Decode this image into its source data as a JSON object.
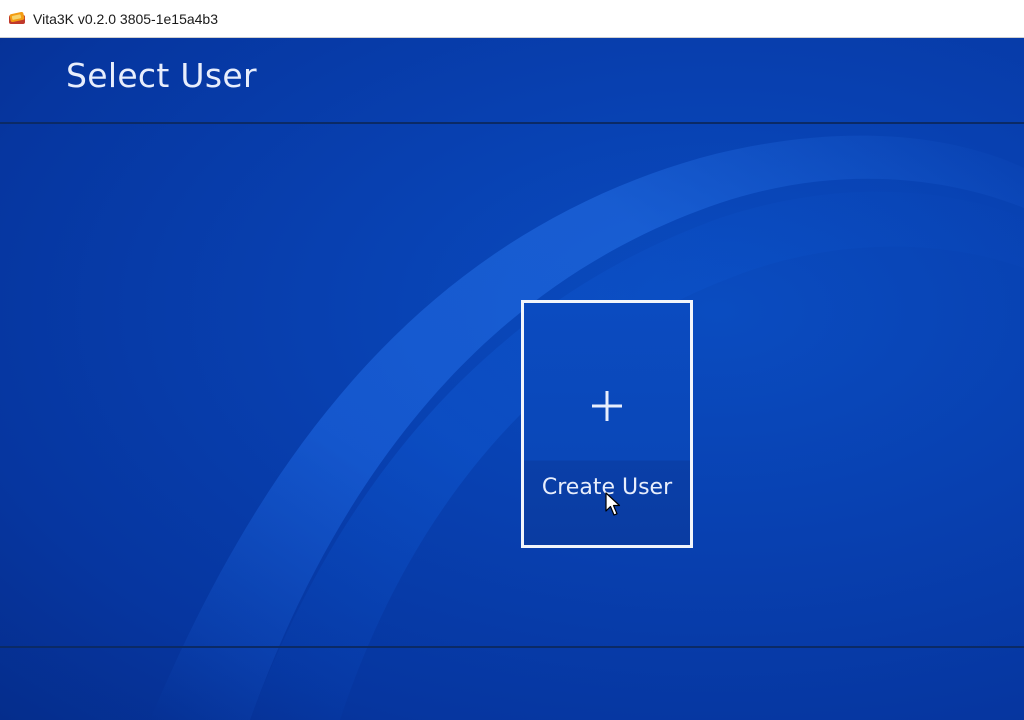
{
  "window": {
    "title": "Vita3K v0.2.0 3805-1e15a4b3",
    "icon": "vita3k-app-icon"
  },
  "header": {
    "title": "Select User"
  },
  "users": {
    "create_label": "Create User",
    "create_icon": "plus-icon"
  },
  "colors": {
    "background": "#0840b0",
    "text": "#e8eefc",
    "card_border": "#f2f5fb"
  }
}
